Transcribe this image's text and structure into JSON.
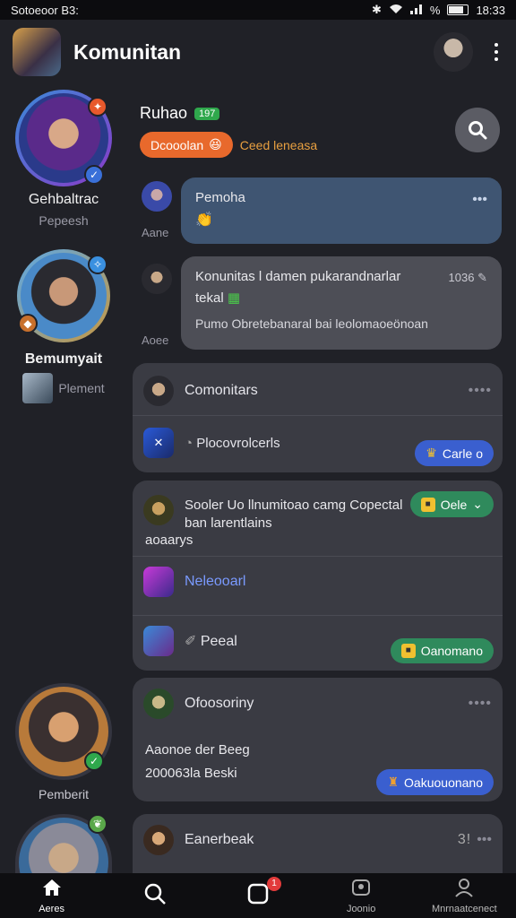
{
  "status_bar": {
    "left_text": "Sotoeoor B3:",
    "time": "18:33",
    "battery_label": "%"
  },
  "header": {
    "title": "Komunitan"
  },
  "sidebar": {
    "users": [
      {
        "name": "Gehbaltrac",
        "sub": "Pepeesh"
      },
      {
        "name": "Bemumyait",
        "sub": "Plement"
      },
      {
        "name": "Pemberit",
        "sub": ""
      }
    ]
  },
  "top_info": {
    "name": "Ruhao",
    "tag": "197",
    "orange_pill": "Dcooolan",
    "orange_text": "Ceed leneasa"
  },
  "messages": [
    {
      "author": "Aane",
      "title": "Pemoha",
      "dots": "•••"
    },
    {
      "author": "Aoee",
      "line1": "Konunitas l damen pukarandnarlar",
      "line2": "tekal",
      "line3": "Pumo Obretebanaral bai leolomaoeönoan",
      "count": "1036"
    }
  ],
  "cards": [
    {
      "rows": [
        {
          "text": "Comonitars",
          "dots": "••••"
        },
        {
          "text": "Plocovrolcerls"
        }
      ],
      "chip": "Carle o"
    },
    {
      "rows": [
        {
          "text1": "Sooler Uo llnumitoao camg  Copectal",
          "text2": "ban larentlains",
          "text3": "aoaarys"
        },
        {
          "text": "Neleooarl"
        },
        {
          "text": "Peeal"
        }
      ],
      "chip_top": "Oele",
      "chip_bottom": "Oanomano"
    },
    {
      "rows": [
        {
          "text": "Ofoosoriny",
          "dots": "••••"
        },
        {
          "text1": "Aaonoe der Beeg",
          "text2": "200063la Beski"
        }
      ],
      "chip": "Oakuouonano"
    },
    {
      "rows": [
        {
          "text": "Eanerbeak",
          "count": "3!",
          "dots": "•••"
        }
      ]
    }
  ],
  "bottom_nav": [
    {
      "label": "Aeres"
    },
    {
      "label": ""
    },
    {
      "label": "",
      "badge": "1"
    },
    {
      "label": "Joonio"
    },
    {
      "label": "Mnrnaatcenect"
    }
  ]
}
